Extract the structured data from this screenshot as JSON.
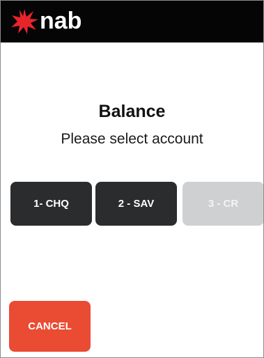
{
  "header": {
    "brand": "nab",
    "logo_icon": "nab-star-icon",
    "background_color": "#050505",
    "logo_color": "#e8242b"
  },
  "main": {
    "title": "Balance",
    "subtitle": "Please select account"
  },
  "accounts": [
    {
      "label": "1- CHQ",
      "enabled": true,
      "color": "#2a2c2d"
    },
    {
      "label": "2 - SAV",
      "enabled": true,
      "color": "#2a2c2d"
    },
    {
      "label": "3 - CR",
      "enabled": false,
      "color": "#cfd0d2"
    }
  ],
  "cancel": {
    "label": "CANCEL",
    "color": "#ea4b33"
  }
}
